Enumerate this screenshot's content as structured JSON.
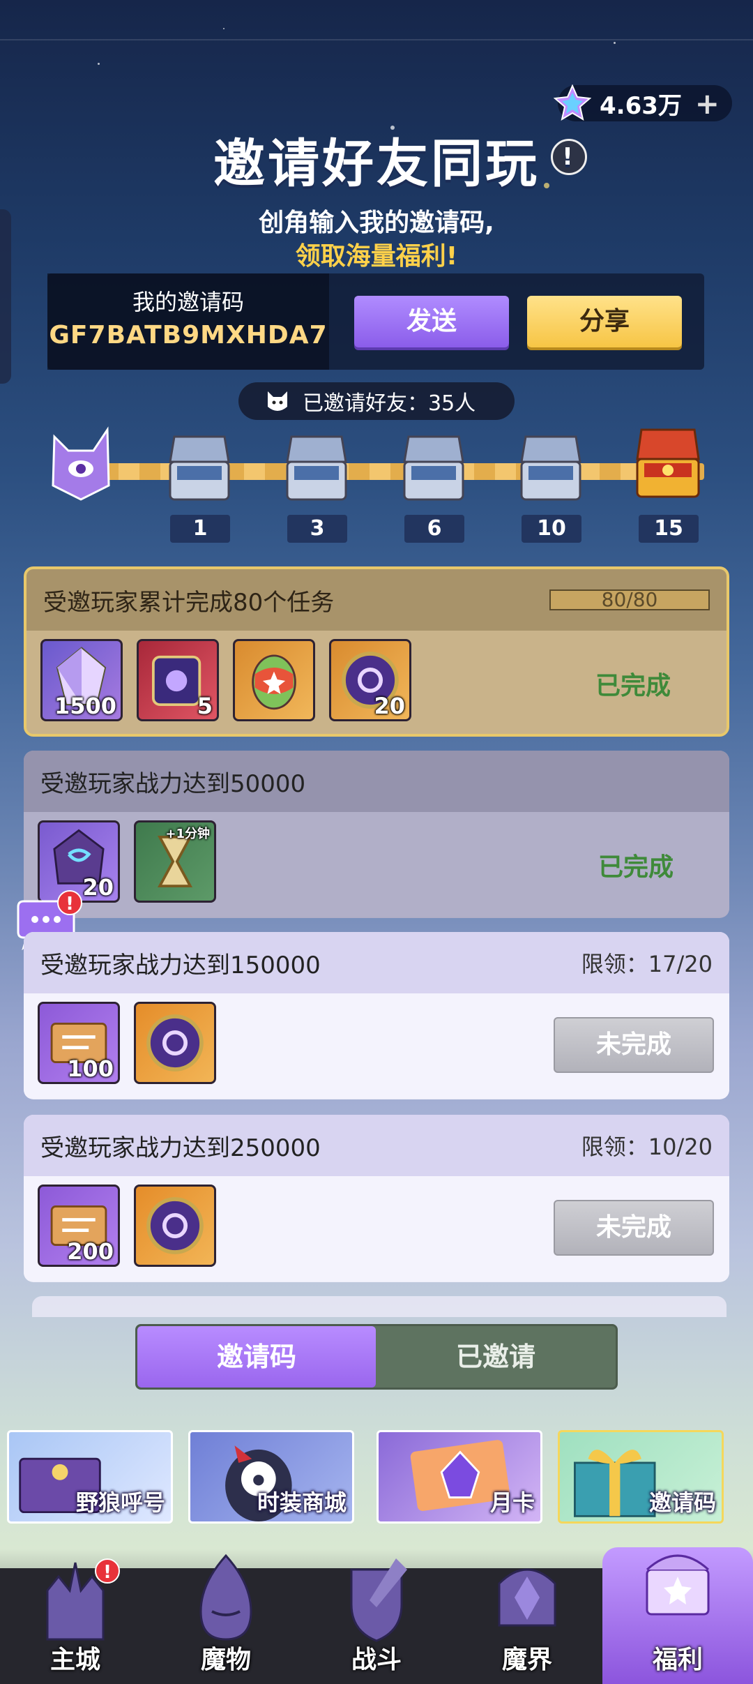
{
  "header": {
    "currency_amount": "4.63万",
    "currency_plus": "+",
    "title": "邀请好友同玩",
    "info_glyph": "!",
    "subtitle_line1": "创角输入我的邀请码,",
    "subtitle_line2": "领取海量福利!"
  },
  "invite": {
    "label": "我的邀请码",
    "code": "GF7BATB9MXHDA7",
    "send_label": "发送",
    "share_label": "分享",
    "invited_count_text": "已邀请好友：35人"
  },
  "milestones": [
    "1",
    "3",
    "6",
    "10",
    "15"
  ],
  "tasks": [
    {
      "title": "受邀玩家累计完成80个任务",
      "progress_text": "80/80",
      "progress": 1.0,
      "status": "已完成",
      "rewards": [
        {
          "icon": "crystal-icon",
          "count": "1500"
        },
        {
          "icon": "scroll-icon",
          "count": "5"
        },
        {
          "icon": "egg-icon",
          "count": ""
        },
        {
          "icon": "coin-icon",
          "count": "20"
        }
      ]
    },
    {
      "title": "受邀玩家战力达到50000",
      "status": "已完成",
      "rewards": [
        {
          "icon": "rune-stone-icon",
          "count": "20"
        },
        {
          "icon": "hourglass-icon",
          "count": "",
          "tag": "+1分钟"
        }
      ]
    },
    {
      "title": "受邀玩家战力达到150000",
      "limit": "限领：17/20",
      "status": "未完成",
      "rewards": [
        {
          "icon": "scroll-icon",
          "count": "100"
        },
        {
          "icon": "coin-icon",
          "count": ""
        }
      ]
    },
    {
      "title": "受邀玩家战力达到250000",
      "limit": "限领：10/20",
      "status": "未完成",
      "rewards": [
        {
          "icon": "scroll-icon",
          "count": "200"
        },
        {
          "icon": "coin-icon",
          "count": ""
        }
      ]
    }
  ],
  "segment": {
    "tab_active": "邀请码",
    "tab_other": "已邀请"
  },
  "promos": [
    "野狼呼号",
    "时装商城",
    "月卡",
    "邀请码"
  ],
  "nav": [
    "主城",
    "魔物",
    "战斗",
    "魔界",
    "福利"
  ],
  "badge_glyph": "!",
  "colors": {
    "accent_purple": "#9a66ee",
    "accent_gold": "#f7c545",
    "done_green": "#3f8a3a"
  }
}
